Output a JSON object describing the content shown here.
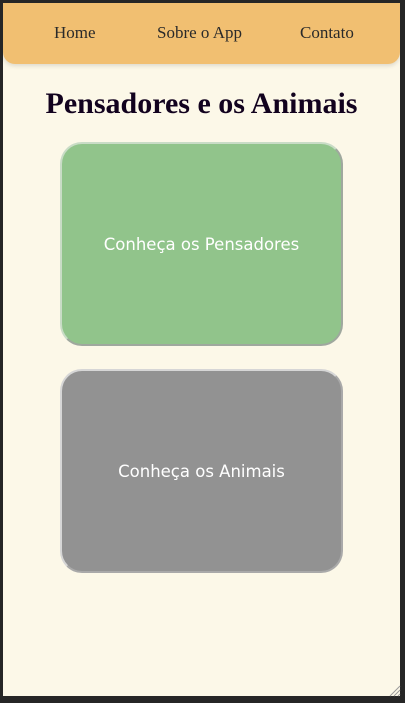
{
  "nav": {
    "home": "Home",
    "about": "Sobre o App",
    "contact": "Contato"
  },
  "page": {
    "title": "Pensadores e os Animais"
  },
  "cards": {
    "pensadores": "Conheça os Pensadores",
    "animais": "Conheça os Animais"
  },
  "colors": {
    "navbar": "#f1bf71",
    "background": "#fcf8e8",
    "card_pensadores": "#91c48b",
    "card_animais": "#929292",
    "title": "#12021e"
  }
}
